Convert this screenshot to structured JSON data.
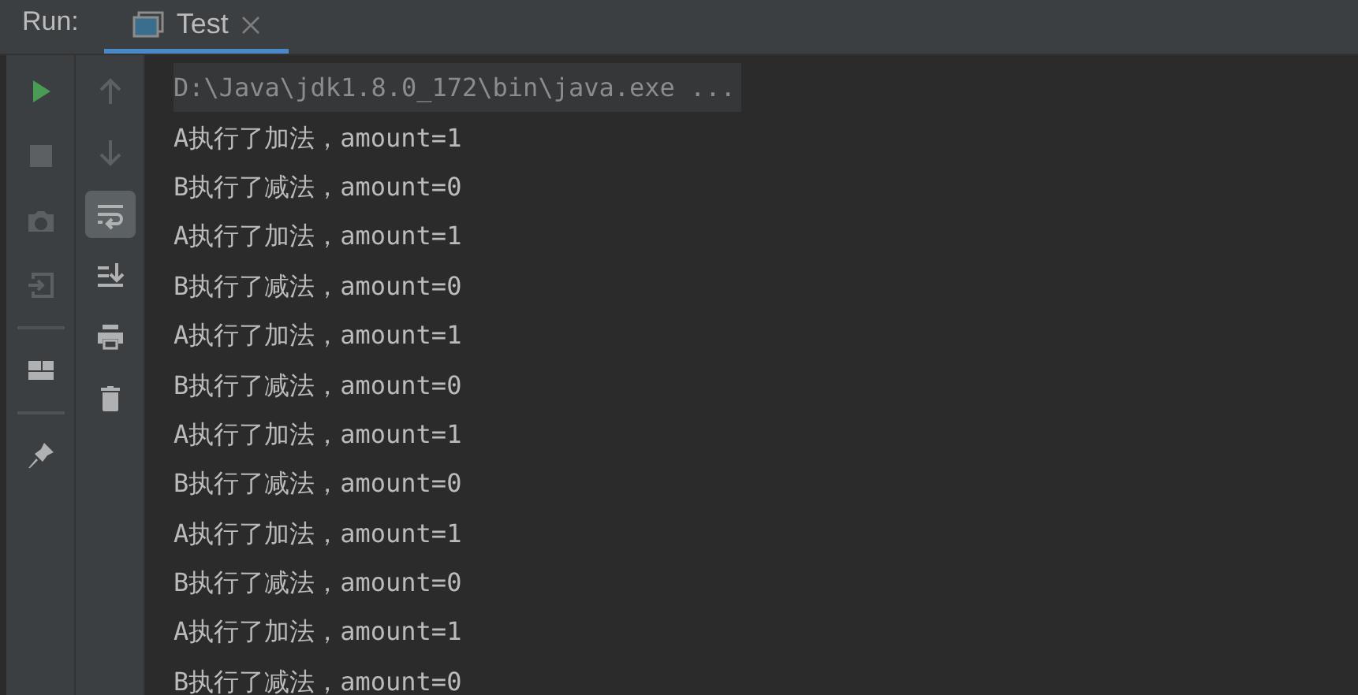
{
  "header": {
    "title": "Run:",
    "tabs": [
      {
        "label": "Test",
        "selected": true
      }
    ]
  },
  "left_toolbar": [
    {
      "kind": "run",
      "disabled": false
    },
    {
      "kind": "stop",
      "disabled": true
    },
    {
      "kind": "camera",
      "disabled": true
    },
    {
      "kind": "enter",
      "disabled": true
    },
    {
      "kind": "divider"
    },
    {
      "kind": "layout",
      "disabled": false
    },
    {
      "kind": "divider"
    },
    {
      "kind": "pin",
      "disabled": false
    }
  ],
  "console_toolbar": [
    {
      "kind": "up",
      "disabled": true,
      "selected": false
    },
    {
      "kind": "down",
      "disabled": true,
      "selected": false
    },
    {
      "kind": "wrap",
      "disabled": false,
      "selected": true
    },
    {
      "kind": "scroll-end",
      "disabled": false,
      "selected": false
    },
    {
      "kind": "print",
      "disabled": false,
      "selected": false
    },
    {
      "kind": "trash",
      "disabled": false,
      "selected": false
    }
  ],
  "console": [
    {
      "kind": "command",
      "text": "D:\\Java\\jdk1.8.0_172\\bin\\java.exe ..."
    },
    {
      "kind": "output",
      "text": "A执行了加法，amount=1"
    },
    {
      "kind": "output",
      "text": "B执行了减法，amount=0"
    },
    {
      "kind": "output",
      "text": "A执行了加法，amount=1"
    },
    {
      "kind": "output",
      "text": "B执行了减法，amount=0"
    },
    {
      "kind": "output",
      "text": "A执行了加法，amount=1"
    },
    {
      "kind": "output",
      "text": "B执行了减法，amount=0"
    },
    {
      "kind": "output",
      "text": "A执行了加法，amount=1"
    },
    {
      "kind": "output",
      "text": "B执行了减法，amount=0"
    },
    {
      "kind": "output",
      "text": "A执行了加法，amount=1"
    },
    {
      "kind": "output",
      "text": "B执行了减法，amount=0"
    },
    {
      "kind": "output",
      "text": "A执行了加法，amount=1"
    },
    {
      "kind": "output",
      "text": "B执行了减法，amount=0"
    }
  ]
}
